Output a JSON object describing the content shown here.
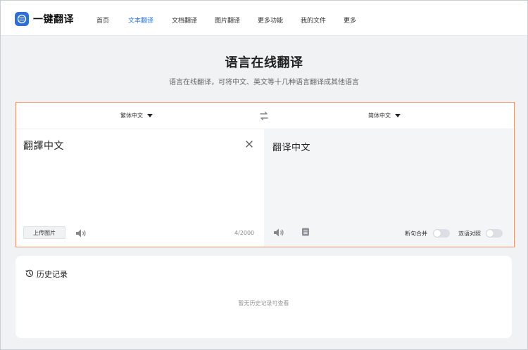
{
  "app": {
    "logo_text": "一键翻译"
  },
  "nav": {
    "items": [
      {
        "label": "首页",
        "active": false
      },
      {
        "label": "文本翻译",
        "active": true
      },
      {
        "label": "文档翻译",
        "active": false
      },
      {
        "label": "图片翻译",
        "active": false
      },
      {
        "label": "更多功能",
        "active": false
      },
      {
        "label": "我的文件",
        "active": false
      },
      {
        "label": "更多",
        "active": false
      }
    ]
  },
  "hero": {
    "title": "语言在线翻译",
    "subtitle": "语言在线翻译，可将中文、英文等十几种语言翻译成其他语言"
  },
  "translator": {
    "source_lang": "繁体中文",
    "target_lang": "简体中文",
    "source_text": "翻譯中文",
    "target_text": "翻译中文",
    "upload_label": "上传图片",
    "char_count": "4/2000",
    "toggle_merge_label": "断句合并",
    "toggle_bilingual_label": "双语对照",
    "accent_color": "#f0906a"
  },
  "history": {
    "title": "历史记录",
    "empty_text": "暂无历史记录可查看"
  },
  "colors": {
    "nav_active": "#2a7ae2",
    "logo_bg": "#2a6fdb"
  }
}
